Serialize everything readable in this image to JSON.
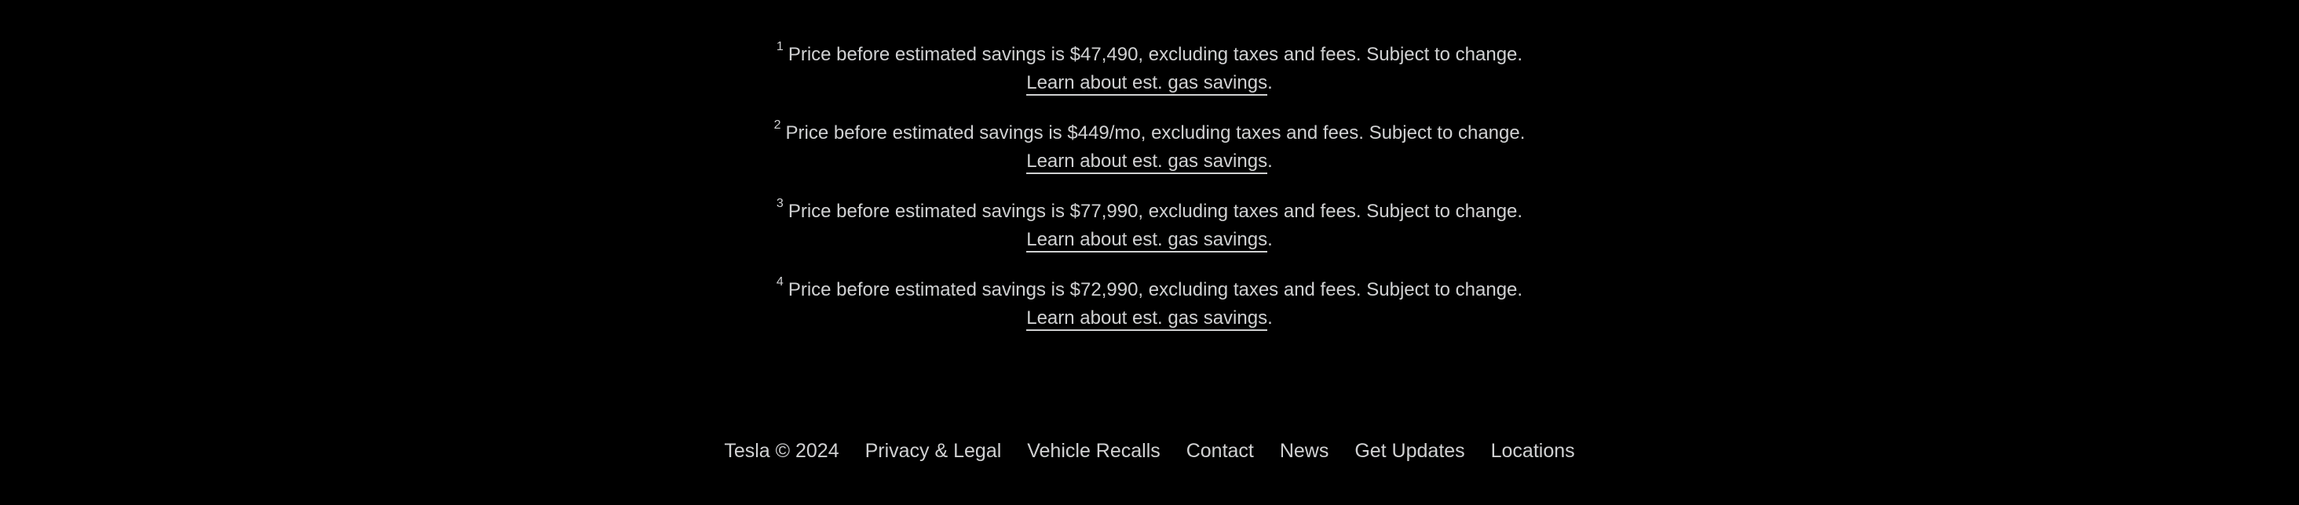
{
  "colors": {
    "background": "#000000",
    "text": "#d0d1d2"
  },
  "disclaimers": [
    {
      "marker": "1",
      "text": "Price before estimated savings is $47,490, excluding taxes and fees. Subject to change.",
      "link": "Learn about est. gas savings",
      "suffix": "."
    },
    {
      "marker": "2",
      "text": "Price before estimated savings is $449/mo, excluding taxes and fees. Subject to change.",
      "link": "Learn about est. gas savings",
      "suffix": "."
    },
    {
      "marker": "3",
      "text": "Price before estimated savings is $77,990, excluding taxes and fees. Subject to change.",
      "link": "Learn about est. gas savings",
      "suffix": "."
    },
    {
      "marker": "4",
      "text": "Price before estimated savings is $72,990, excluding taxes and fees. Subject to change.",
      "link": "Learn about est. gas savings",
      "suffix": "."
    }
  ],
  "footer": {
    "copyright": "Tesla © 2024",
    "links": [
      "Privacy & Legal",
      "Vehicle Recalls",
      "Contact",
      "News",
      "Get Updates",
      "Locations"
    ]
  }
}
